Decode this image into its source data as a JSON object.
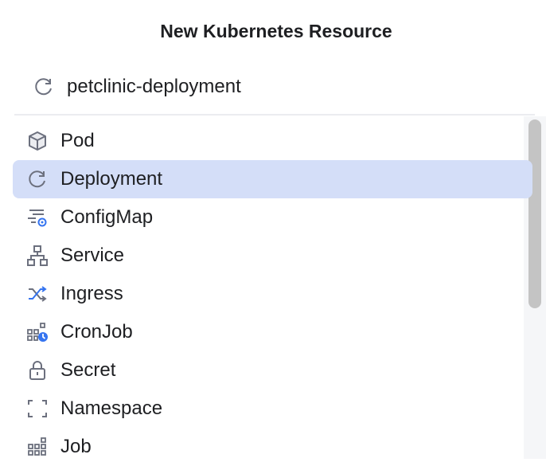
{
  "dialog": {
    "title": "New Kubernetes Resource"
  },
  "search": {
    "value": "petclinic-deployment",
    "icon": "refresh-icon"
  },
  "items": [
    {
      "label": "Pod",
      "icon": "cube-icon"
    },
    {
      "label": "Deployment",
      "icon": "refresh-icon",
      "selected": true
    },
    {
      "label": "ConfigMap",
      "icon": "config-gear-icon"
    },
    {
      "label": "Service",
      "icon": "hierarchy-icon"
    },
    {
      "label": "Ingress",
      "icon": "shuffle-icon"
    },
    {
      "label": "CronJob",
      "icon": "grid-clock-icon"
    },
    {
      "label": "Secret",
      "icon": "lock-icon"
    },
    {
      "label": "Namespace",
      "icon": "brackets-icon"
    },
    {
      "label": "Job",
      "icon": "grid-icon"
    }
  ],
  "colors": {
    "selection": "#d4def8",
    "accent": "#3574f0",
    "icon": "#6c707e"
  }
}
